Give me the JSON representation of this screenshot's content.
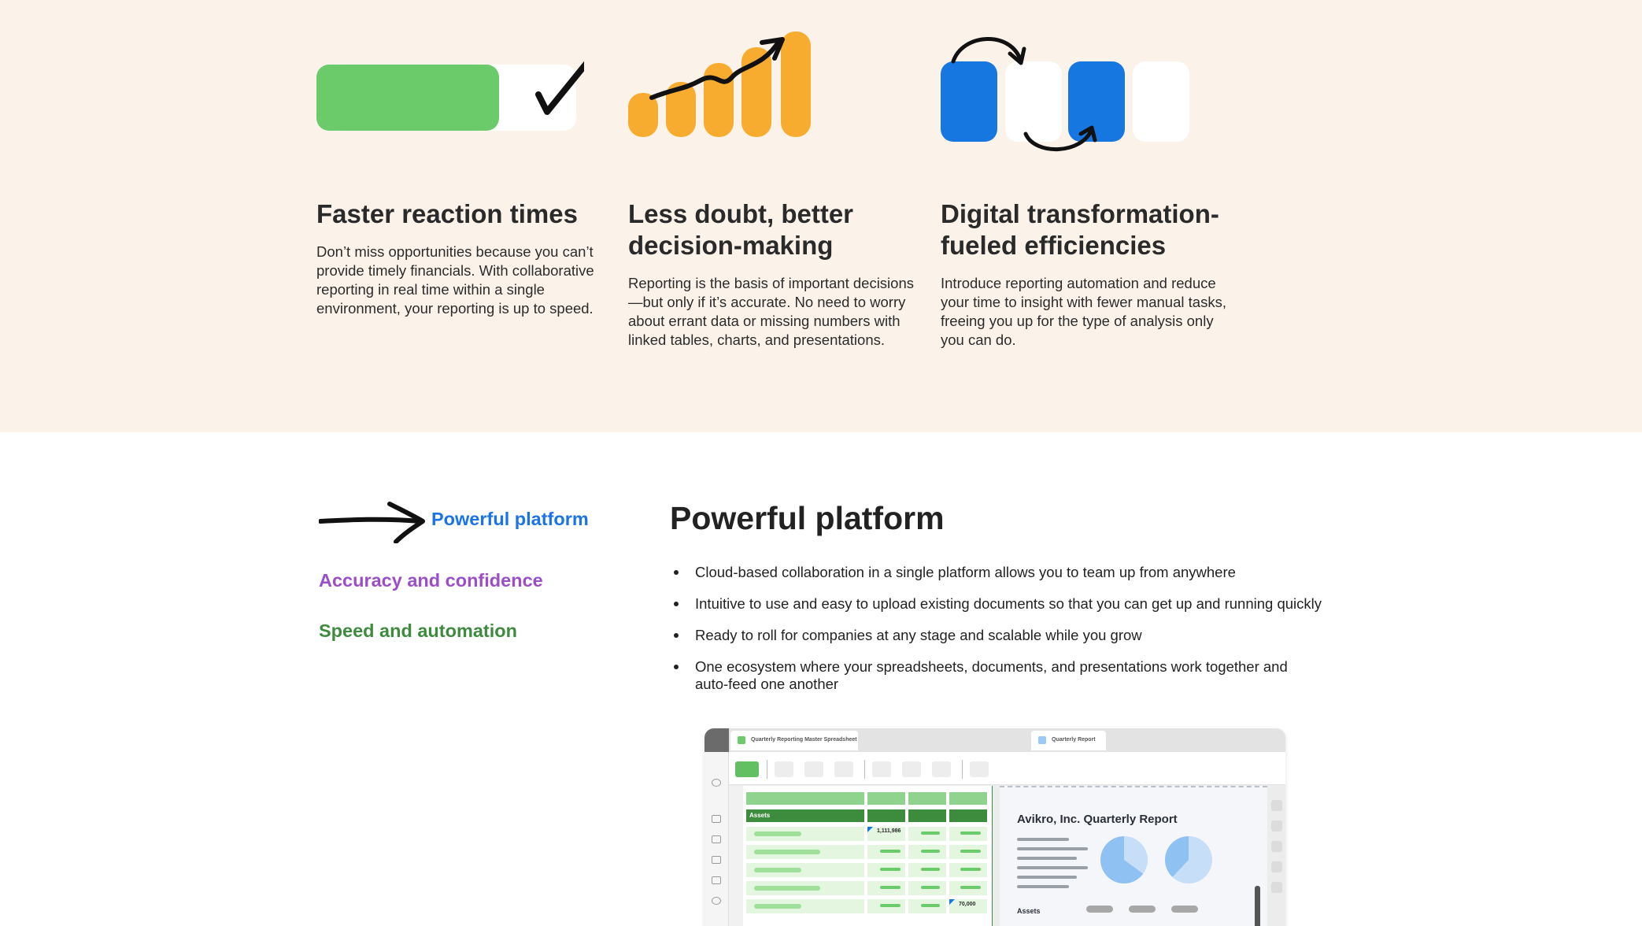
{
  "benefits": [
    {
      "title": "Faster reaction times",
      "body": "Don’t miss opportunities because you can’t provide timely financials. With collaborative reporting in real time within a single environment, your reporting is up to speed.",
      "icon": "progress-check-illustration",
      "accent": "#6bcb6b"
    },
    {
      "title": "Less doubt, better decision-making",
      "body": "Reporting is the basis of important decisions—but only if it’s accurate. No need to worry about errant data or missing numbers with linked tables, charts, and presentations.",
      "icon": "rising-bars-illustration",
      "accent": "#f8ac2f"
    },
    {
      "title": "Digital transformation-fueled efficiencies",
      "body": "Introduce reporting automation and reduce your time to insight with fewer manual tasks, freeing you up for the type of analysis only you can do.",
      "icon": "swap-blocks-illustration",
      "accent": "#1677e0"
    }
  ],
  "platform": {
    "tabs": [
      {
        "label": "Powerful platform",
        "active": true,
        "color": "#1a73e8"
      },
      {
        "label": "Accuracy and confidence",
        "active": false,
        "color": "#9b4dca"
      },
      {
        "label": "Speed and automation",
        "active": false,
        "color": "#3d8b3d"
      }
    ],
    "heading": "Powerful platform",
    "bullets": [
      "Cloud-based collaboration in a single platform allows you to team up from anywhere",
      "Intuitive to use and easy to upload existing documents so that you can get up and running quickly",
      "Ready to roll for companies at any stage and scalable while you grow",
      "One ecosystem where your spreadsheets, documents, and presentations work together and auto-feed one another"
    ]
  },
  "mock": {
    "sheet_tab": "Quarterly Reporting Master Spreadsheet",
    "report_tab": "Quarterly Report",
    "assets_label": "Assets",
    "value_1": "1,111,986",
    "value_2": "70,000",
    "report_title": "Avikro, Inc. Quarterly Report",
    "report_assets_label": "Assets"
  },
  "colors": {
    "beige_bg": "#fbf3ea",
    "green": "#6bcb6b",
    "orange": "#f8ac2f",
    "blue": "#1677e0",
    "link_blue": "#1a73e8",
    "purple": "#9b4dca",
    "dark_green": "#3d8b3d"
  }
}
